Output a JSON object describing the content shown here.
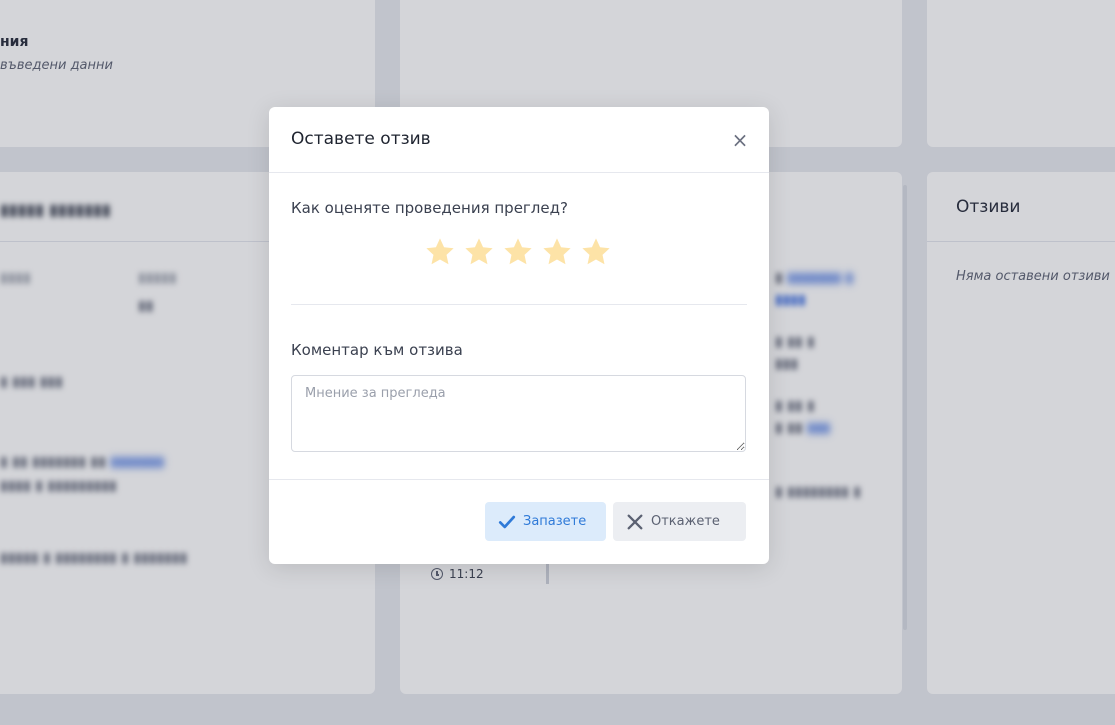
{
  "background": {
    "section_title_fragment": "ния",
    "section_subtitle_fragment": "въведени данни",
    "reviews_card": {
      "title": "Отзиви",
      "empty_text": "Няма оставени отзиви"
    },
    "timeline": {
      "time": "11:12"
    }
  },
  "modal": {
    "title": "Оставете отзив",
    "close_label": "×",
    "rating_question": "Как оценяте проведения преглед?",
    "rating": {
      "max": 5,
      "selected": 0,
      "star_color": "#fde3a7"
    },
    "comment": {
      "label": "Коментар към отзива",
      "placeholder": "Мнение за прегледа",
      "value": ""
    },
    "buttons": {
      "save_label": "Запазете",
      "save_icon": "check-icon",
      "cancel_label": "Откажете",
      "cancel_icon": "x-icon"
    }
  },
  "colors": {
    "accent": "#2f7ad8",
    "accent_bg": "#dcebfb",
    "neutral_button_bg": "#eceef2",
    "overlay": "rgba(60,64,80,0.22)"
  }
}
